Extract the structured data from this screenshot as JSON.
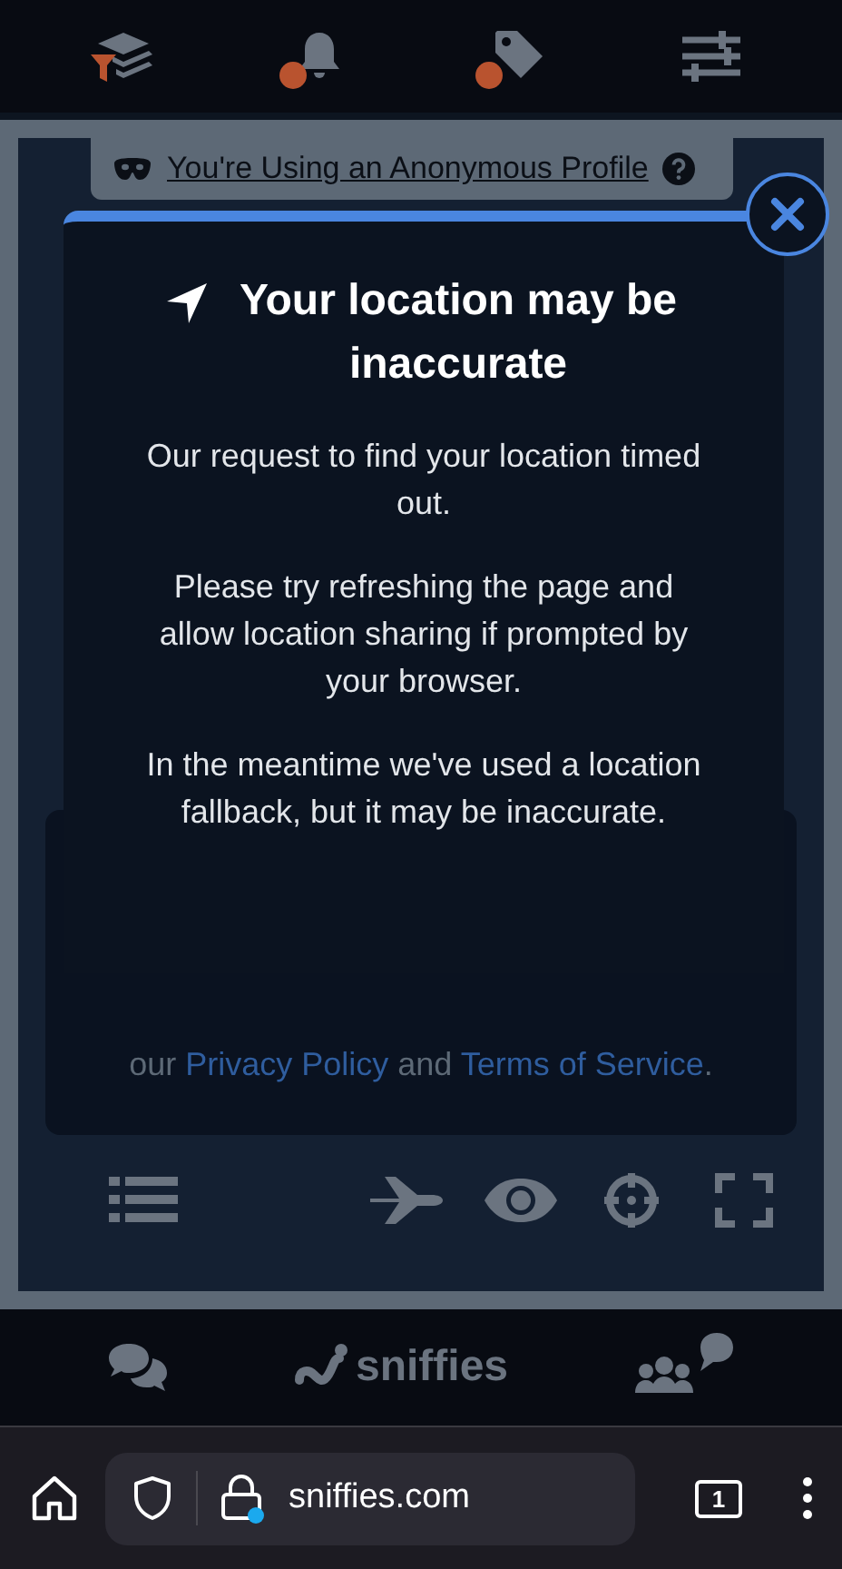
{
  "top_nav": [
    {
      "kind": "layers",
      "badge": false
    },
    {
      "kind": "bell",
      "badge": true
    },
    {
      "kind": "tag",
      "badge": true
    },
    {
      "kind": "sliders",
      "badge": false
    }
  ],
  "anonymous_banner": {
    "text": "You're Using an Anonymous Profile"
  },
  "modal": {
    "title": "Your location may be inaccurate",
    "paragraphs": [
      "Our request to find your location timed out.",
      "Please try refreshing the page and allow location sharing if prompted by your browser.",
      "In the meantime we've used a location fallback, but it may be inaccurate."
    ]
  },
  "background_card": {
    "segments": [
      {
        "kind": "plain",
        "text": "our"
      },
      {
        "kind": "link",
        "text": "Privacy Policy"
      },
      {
        "kind": "plain",
        "text": "and"
      },
      {
        "kind": "link",
        "text": "Terms of Service"
      },
      {
        "kind": "plain",
        "text": "."
      }
    ]
  },
  "map_toolbar": [
    {
      "kind": "list"
    },
    {
      "kind": "airplane"
    },
    {
      "kind": "eye"
    },
    {
      "kind": "crosshair"
    },
    {
      "kind": "expand"
    }
  ],
  "bottom_nav": {
    "logo": "sniffies"
  },
  "browser": {
    "url": "sniffies.com",
    "tab_count": "1"
  }
}
